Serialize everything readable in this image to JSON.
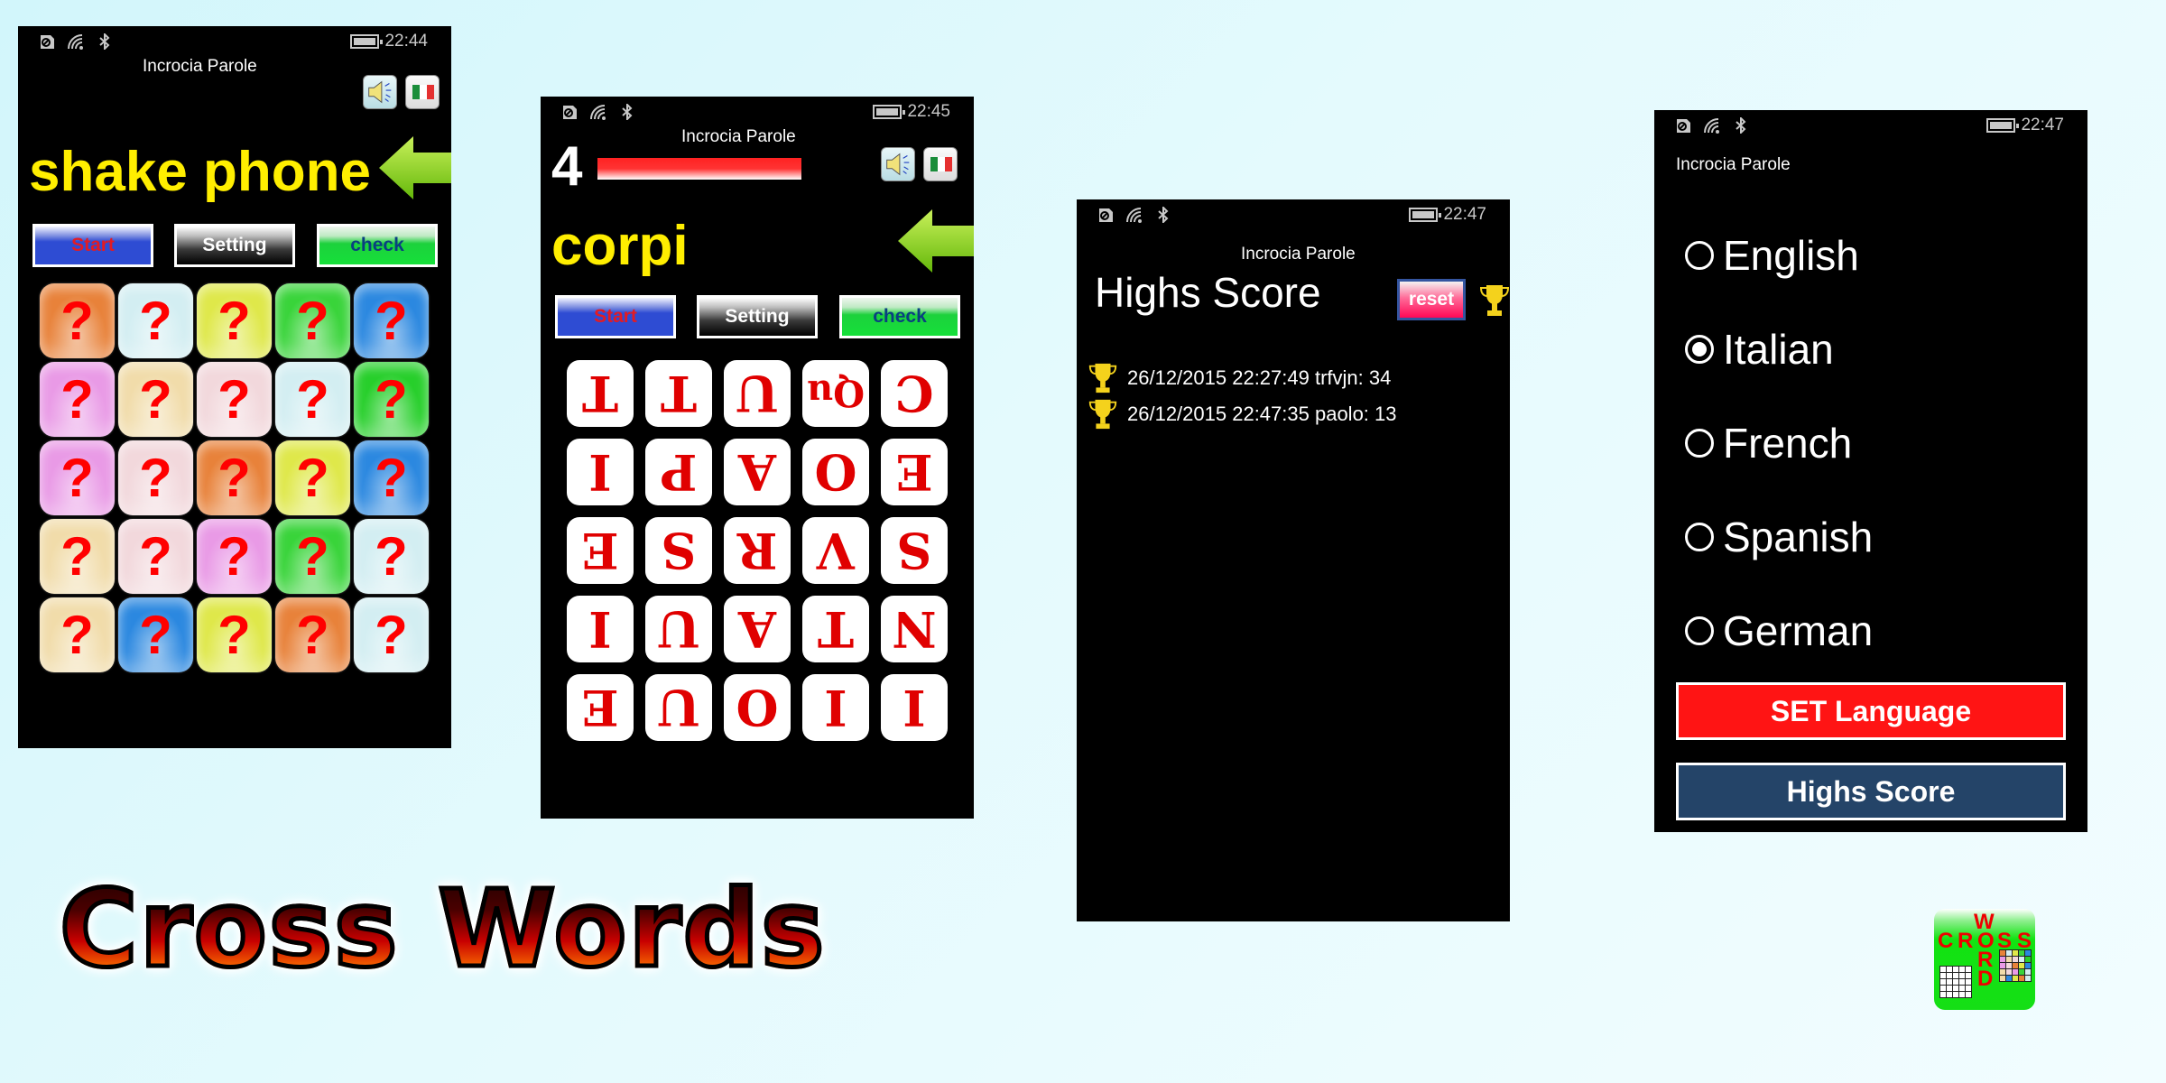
{
  "status_icons": [
    "sim-icon",
    "wifi-icon",
    "bluetooth-icon",
    "battery-charging-icon"
  ],
  "app_title": "Incrocia Parole",
  "screens": {
    "shake": {
      "time": "22:44",
      "hint": "shake phone",
      "buttons": {
        "start": "Start",
        "setting": "Setting",
        "check": "check"
      },
      "tile_symbol": "?",
      "tile_colors": [
        "#e8823a",
        "#d3eef2",
        "#dfe84a",
        "#39d43a",
        "#2b88e0",
        "#e99ae6",
        "#f1dcaa",
        "#f2d8dc",
        "#d3eef2",
        "#27cf2b",
        "#e99ae6",
        "#f2d8dc",
        "#e8823a",
        "#dfe84a",
        "#2b88e0",
        "#f1dcaa",
        "#f2d8dc",
        "#e99ae6",
        "#39d43a",
        "#d3eef2",
        "#f1dcaa",
        "#2b88e0",
        "#dfe84a",
        "#e8823a",
        "#d3eef2"
      ]
    },
    "game": {
      "time": "22:45",
      "score": "4",
      "timer_fraction": 1.0,
      "word": "corpi",
      "buttons": {
        "start": "Start",
        "setting": "Setting",
        "check": "check"
      },
      "letters": [
        "T",
        "T",
        "U",
        "Qu",
        "C",
        "I",
        "P",
        "A",
        "O",
        "E",
        "E",
        "S",
        "R",
        "V",
        "S",
        "I",
        "U",
        "A",
        "T",
        "N",
        "E",
        "U",
        "O",
        "I",
        "I"
      ]
    },
    "highscore": {
      "time": "22:47",
      "title": "Highs Score",
      "reset_label": "reset",
      "entries": [
        "26/12/2015 22:27:49 trfvjn: 34",
        "26/12/2015 22:47:35 paolo: 13"
      ]
    },
    "settings": {
      "time": "22:47",
      "languages": [
        {
          "label": "English",
          "selected": false
        },
        {
          "label": "Italian",
          "selected": true
        },
        {
          "label": "French",
          "selected": false
        },
        {
          "label": "Spanish",
          "selected": false
        },
        {
          "label": "German",
          "selected": false
        }
      ],
      "set_language_label": "SET Language",
      "highs_score_label": "Highs Score"
    }
  },
  "promo": {
    "logo_text": "Cross Words",
    "app_icon": {
      "horizontal": "CROSS",
      "vertical": "WORD"
    }
  }
}
